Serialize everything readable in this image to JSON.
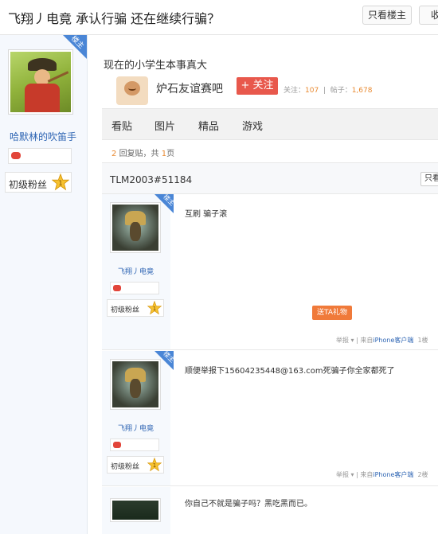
{
  "header": {
    "title": "飞翔丿电竟 承认行骗 还在继续行骗？",
    "only_op_label": "只看楼主",
    "reply_label": "收"
  },
  "op": {
    "corner_label": "楼主",
    "username": "哈默林的吹笛手",
    "level_label": "初级粉丝",
    "level_num": "1",
    "badge_icon": "gamepad-icon"
  },
  "post": {
    "text": "现在的小学生本事真大"
  },
  "screenshot": {
    "forum": {
      "name": "炉石友谊赛吧",
      "follow_label": "+ 关注",
      "followers_label": "关注：",
      "followers": "107",
      "posts_label": "帖子：",
      "posts": "1,678"
    },
    "tabs": [
      "看贴",
      "图片",
      "精品",
      "游戏"
    ],
    "reply_meta": {
      "count": "2",
      "text": "回复贴，共",
      "pages": "1",
      "pages_suffix": "页"
    },
    "thread_title": "TLM2003#51184",
    "only_op_label": "只看",
    "posts": [
      {
        "corner_label": "楼主",
        "user": "飞翔丿电竟",
        "level_label": "初级粉丝",
        "level_num": "1",
        "content": "互刷 骗子滚",
        "gift_label": "送TA礼物",
        "report": "举报",
        "from_prefix": "| 来自",
        "client": "iPhone客户端",
        "floor": "1楼"
      },
      {
        "corner_label": "楼主",
        "user": "飞翔丿电竟",
        "level_label": "初级粉丝",
        "level_num": "1",
        "content": "顺便举报下15604235448@163.com死骗子你全家都死了",
        "report": "举报",
        "from_prefix": "| 来自",
        "client": "iPhone客户端",
        "floor": "2楼"
      },
      {
        "content": "你自己不就是骗子吗？黑吃黑而已。"
      }
    ]
  },
  "colors": {
    "accent_blue": "#4a86d6",
    "link_blue": "#2d64b3",
    "follow_red": "#e8584c",
    "gift_orange": "#f07a3a",
    "number_orange": "#e98a31"
  }
}
